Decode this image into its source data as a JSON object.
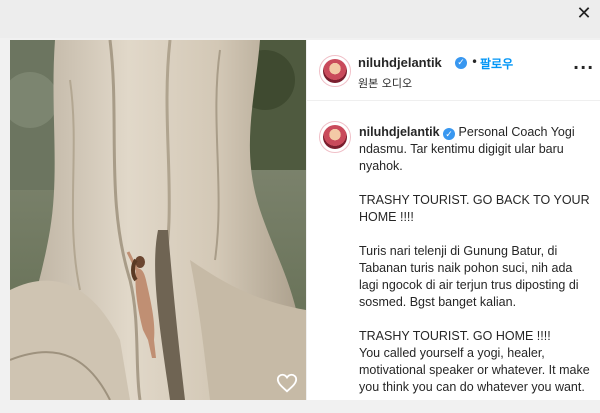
{
  "header": {
    "username": "niluhdjelantik",
    "separator": "•",
    "follow_label": "팔로우",
    "audio_label": "원본 오디오",
    "more_label": "···"
  },
  "caption": {
    "username": "niluhdjelantik",
    "first_line": "Personal Coach Yogi ndasmu. Tar kentimu digigit ular baru nyahok.",
    "paragraphs": [
      "TRASHY TOURIST. GO BACK TO YOUR HOME !!!!",
      "Turis nari telenji di Gunung Batur, di Tabanan turis naik pohon suci, nih ada lagi ngocok di air terjun trus diposting di sosmed. Bgst banget kalian.",
      "TRASHY TOURIST. GO HOME !!!!\nYou called yourself a yogi, healer, motivational speaker or whatever. It make you think you can do whatever you want."
    ]
  },
  "window": {
    "close_label": "✕"
  },
  "colors": {
    "follow_blue": "#0095f6",
    "verified_blue": "#3897f0",
    "text": "#262626"
  },
  "icons": {
    "like": "heart-icon",
    "verified": "verified-badge-icon",
    "close": "close-icon",
    "more": "more-options-icon"
  }
}
